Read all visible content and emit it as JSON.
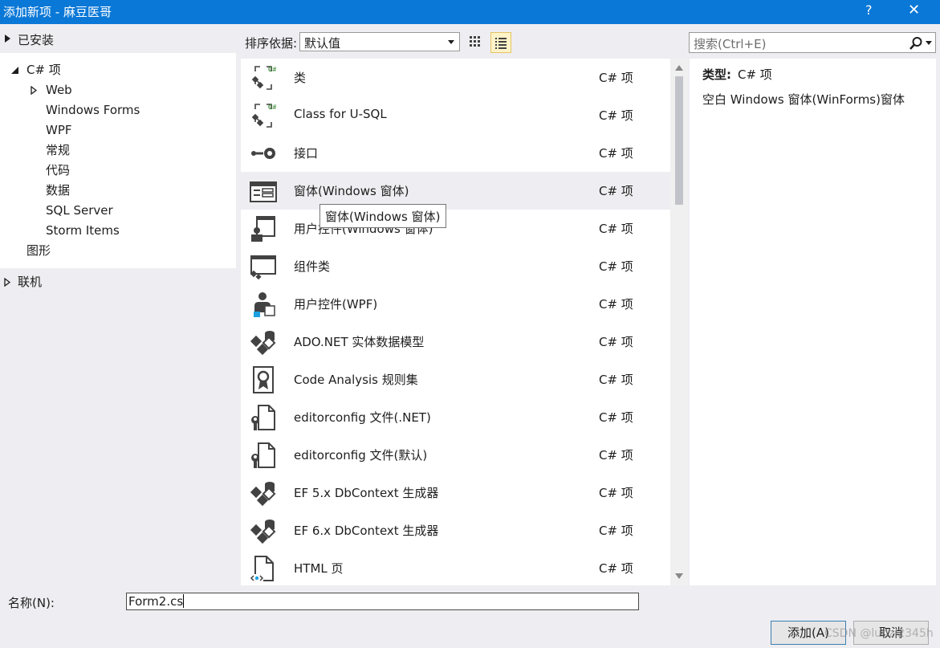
{
  "window": {
    "title": "添加新项 - 麻豆医哥",
    "help": "?",
    "close": "✕"
  },
  "sidebar": {
    "installed_label": "已安装",
    "tree": [
      {
        "label": "C# 项"
      },
      {
        "label": "Web"
      },
      {
        "label": "Windows Forms"
      },
      {
        "label": "WPF"
      },
      {
        "label": "常规"
      },
      {
        "label": "代码"
      },
      {
        "label": "数据"
      },
      {
        "label": "SQL Server"
      },
      {
        "label": "Storm Items"
      },
      {
        "label": "图形"
      }
    ],
    "online_label": "联机"
  },
  "toolbar": {
    "sort_label": "排序依据:",
    "sort_value": "默认值",
    "view_mode": "list"
  },
  "search": {
    "placeholder": "搜索(Ctrl+E)"
  },
  "items": [
    {
      "name": "类",
      "type": "C# 项",
      "icon": "class-icon"
    },
    {
      "name": "Class for U-SQL",
      "type": "C# 项",
      "icon": "class-usql-icon"
    },
    {
      "name": "接口",
      "type": "C# 项",
      "icon": "interface-icon"
    },
    {
      "name": "窗体(Windows 窗体)",
      "type": "C# 项",
      "icon": "windows-form-icon"
    },
    {
      "name": "用户控件(Windows 窗体)",
      "type": "C# 项",
      "icon": "user-control-icon"
    },
    {
      "name": "组件类",
      "type": "C# 项",
      "icon": "component-icon"
    },
    {
      "name": "用户控件(WPF)",
      "type": "C# 项",
      "icon": "wpf-user-control-icon"
    },
    {
      "name": "ADO.NET 实体数据模型",
      "type": "C# 项",
      "icon": "entity-model-icon"
    },
    {
      "name": "Code Analysis 规则集",
      "type": "C# 项",
      "icon": "ruleset-icon"
    },
    {
      "name": "editorconfig 文件(.NET)",
      "type": "C# 项",
      "icon": "editorconfig-icon"
    },
    {
      "name": "editorconfig 文件(默认)",
      "type": "C# 项",
      "icon": "editorconfig-icon"
    },
    {
      "name": "EF 5.x DbContext 生成器",
      "type": "C# 项",
      "icon": "dbcontext-icon"
    },
    {
      "name": "EF 6.x DbContext 生成器",
      "type": "C# 项",
      "icon": "dbcontext-icon"
    },
    {
      "name": "HTML 页",
      "type": "C# 项",
      "icon": "html-page-icon"
    }
  ],
  "tooltip": "窗体(Windows 窗体)",
  "details": {
    "type_label": "类型:",
    "type_value": "C# 项",
    "description": "空白 Windows 窗体(WinForms)窗体"
  },
  "footer": {
    "name_label": "名称(N):",
    "name_value": "Form2.cs",
    "add_button": "添加(A)",
    "cancel_button": "取消"
  },
  "watermark": "CSDN @lunzi2345h",
  "colors": {
    "titlebar": "#0a78d7",
    "hover_row": "#eeeef2",
    "list_btn_bg": "#fff3c8"
  }
}
